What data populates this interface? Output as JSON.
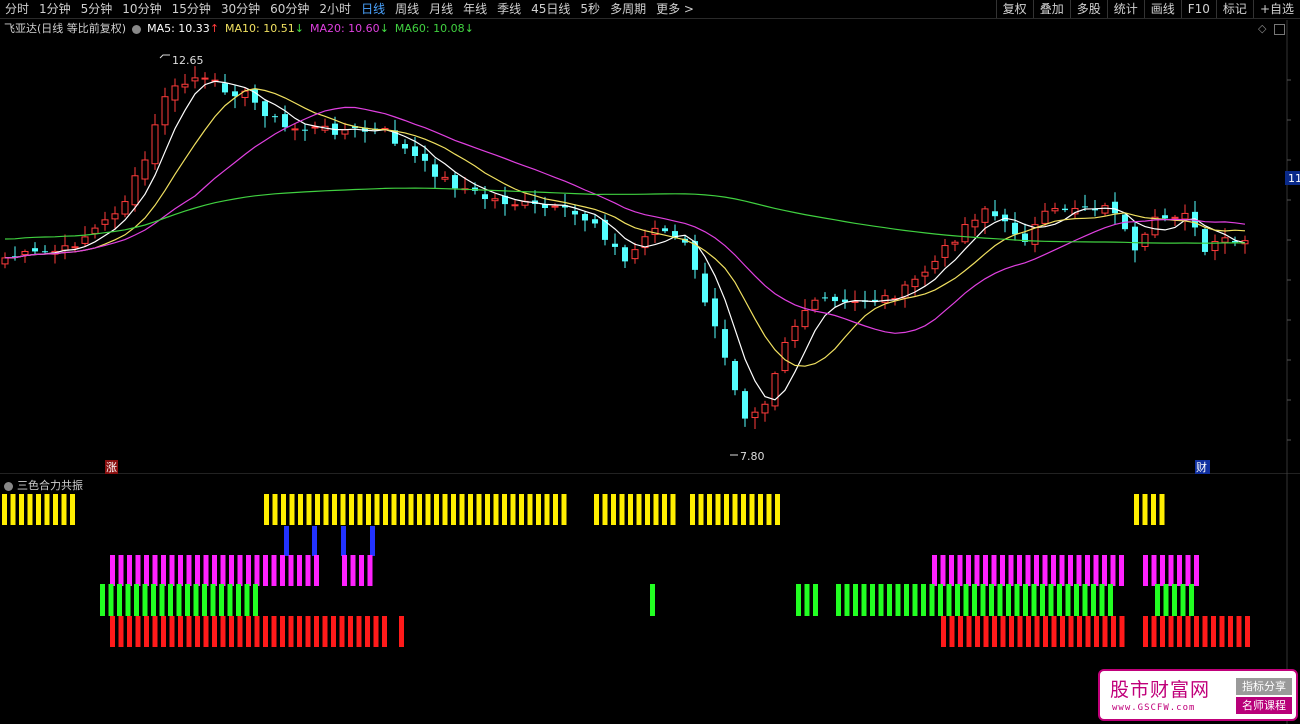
{
  "toolbar": {
    "periods": [
      "分时",
      "1分钟",
      "5分钟",
      "10分钟",
      "15分钟",
      "30分钟",
      "60分钟",
      "2小时",
      "日线",
      "周线",
      "月线",
      "年线",
      "季线",
      "45日线",
      "5秒",
      "多周期",
      "更多 >"
    ],
    "active_period": "日线",
    "right": [
      "复权",
      "叠加",
      "多股",
      "统计",
      "画线",
      "F10",
      "标记",
      "+自选"
    ]
  },
  "main_chart": {
    "title": "飞亚达(日线 等比前复权)",
    "ma": [
      {
        "label": "MA5: 10.33",
        "arrow": "↑",
        "color": "#ffffff",
        "arrow_color": "#ff3b3b"
      },
      {
        "label": "MA10: 10.51",
        "arrow": "↓",
        "color": "#f0e060",
        "arrow_color": "#44dd44"
      },
      {
        "label": "MA20: 10.60",
        "arrow": "↓",
        "color": "#e040e0",
        "arrow_color": "#44dd44"
      },
      {
        "label": "MA60: 10.08",
        "arrow": "↓",
        "color": "#40d040",
        "arrow_color": "#44dd44"
      }
    ],
    "high_label": "12.65",
    "low_label": "7.80",
    "price_tag": "11",
    "badge_zhang": "涨",
    "badge_cai": "财",
    "colors": {
      "up": "#ff3b3b",
      "down": "#54ffff",
      "ma5": "#ffffff",
      "ma10": "#f0e060",
      "ma20": "#e040e0",
      "ma60": "#40d040"
    }
  },
  "indicator": {
    "title": "三色合力共振",
    "colors": {
      "yellow": "#ffee00",
      "blue": "#2233ff",
      "magenta": "#ff22ff",
      "green": "#22ff22",
      "red": "#ff1a1a"
    }
  },
  "watermark": {
    "main": "股市财富网",
    "url": "www.GSCFW.com",
    "tag1": "指标分享",
    "tag2": "名师课程"
  }
}
